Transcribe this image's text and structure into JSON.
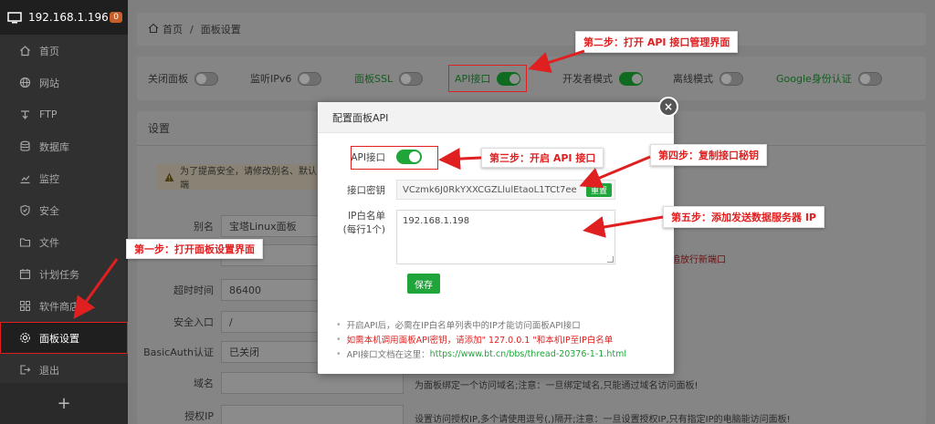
{
  "sidebar": {
    "ip": "192.168.1.196",
    "badge": "0",
    "items": [
      {
        "label": "首页",
        "icon": "home-icon"
      },
      {
        "label": "网站",
        "icon": "globe-icon"
      },
      {
        "label": "FTP",
        "icon": "ftp-icon"
      },
      {
        "label": "数据库",
        "icon": "database-icon"
      },
      {
        "label": "监控",
        "icon": "monitor-chart-icon"
      },
      {
        "label": "安全",
        "icon": "shield-icon"
      },
      {
        "label": "文件",
        "icon": "folder-icon"
      },
      {
        "label": "计划任务",
        "icon": "calendar-icon"
      },
      {
        "label": "软件商店",
        "icon": "grid-icon"
      },
      {
        "label": "面板设置",
        "icon": "gear-icon"
      },
      {
        "label": "退出",
        "icon": "logout-icon"
      }
    ],
    "add": "+"
  },
  "breadcrumb": {
    "home": "首页",
    "sep": "/",
    "current": "面板设置"
  },
  "toggles": [
    {
      "label": "关闭面板"
    },
    {
      "label": "监听IPv6"
    },
    {
      "label": "面板SSL"
    },
    {
      "label": "API接口"
    },
    {
      "label": "开发者模式"
    },
    {
      "label": "离线模式"
    },
    {
      "label": "Google身份认证"
    }
  ],
  "settings": {
    "title": "设置",
    "warning": "为了提高安全，请修改别名、默认端",
    "fields": [
      {
        "label": "别名",
        "value": "宝塔Linux面板"
      },
      {
        "label": "超时时间",
        "value": "86400"
      },
      {
        "label": "安全入口",
        "value": "/"
      },
      {
        "label": "BasicAuth认证",
        "value": "已关闭"
      },
      {
        "label": "域名",
        "value": ""
      },
      {
        "label": "授权IP",
        "value": ""
      }
    ],
    "hints": {
      "port": "追放行新端口",
      "domain": "为面板绑定一个访问域名;注意：一旦绑定域名,只能通过域名访问面板!",
      "ip": "设置访问授权IP,多个请使用逗号(,)隔开;注意：一旦设置授权IP,只有指定IP的电脑能访问面板!"
    }
  },
  "modal": {
    "title": "配置面板API",
    "close": "×",
    "api_label": "API接口",
    "key_label": "接口密钥",
    "key_value": "VCzmk6J0RkYXXCGZLlulEtaoL1TCt7ee",
    "reset": "重置",
    "ip_label": "IP白名单",
    "ip_label2": "(每行1个)",
    "ip_value": "192.168.1.198",
    "save": "保存",
    "notes": [
      "开启API后，必需在IP白名单列表中的IP才能访问面板API接口",
      "如需本机调用面板API密钥，请添加\" 127.0.0.1 \"和本机IP至IP白名单"
    ],
    "doc_prefix": "API接口文档在这里：",
    "doc_link": "https://www.bt.cn/bbs/thread-20376-1-1.html"
  },
  "annotations": {
    "step1": "第一步：打开面板设置界面",
    "step2": "第二步：打开 API 接口管理界面",
    "step3": "第三步：开启 API 接口",
    "step4": "第四步：复制接口秘钥",
    "step5": "第五步：添加发送数据服务器 IP"
  },
  "colors": {
    "accent": "#20a53a",
    "annotation": "#e02020",
    "sidebar": "#303030"
  }
}
